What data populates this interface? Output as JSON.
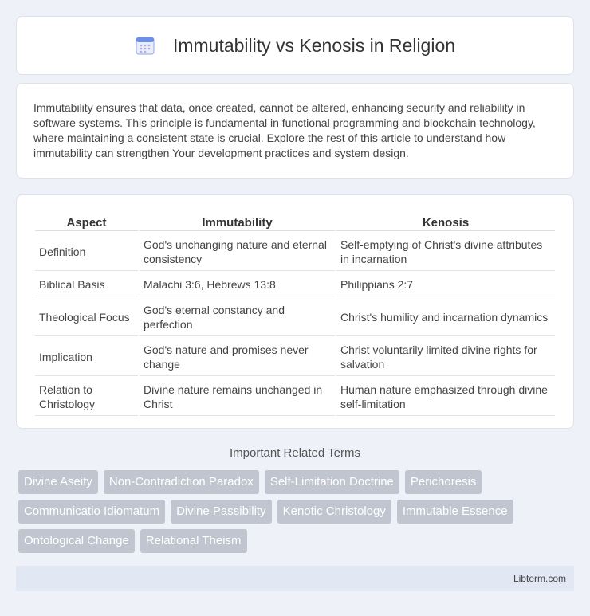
{
  "header": {
    "title": "Immutability vs Kenosis in Religion",
    "icon": "calendar-icon"
  },
  "intro": {
    "text": "Immutability ensures that data, once created, cannot be altered, enhancing security and reliability in software systems. This principle is fundamental in functional programming and blockchain technology, where maintaining a consistent state is crucial. Explore the rest of this article to understand how immutability can strengthen Your development practices and system design."
  },
  "table": {
    "headers": [
      "Aspect",
      "Immutability",
      "Kenosis"
    ],
    "rows": [
      [
        "Definition",
        "God's unchanging nature and eternal consistency",
        "Self-emptying of Christ's divine attributes in incarnation"
      ],
      [
        "Biblical Basis",
        "Malachi 3:6, Hebrews 13:8",
        "Philippians 2:7"
      ],
      [
        "Theological Focus",
        "God's eternal constancy and perfection",
        "Christ's humility and incarnation dynamics"
      ],
      [
        "Implication",
        "God's nature and promises never change",
        "Christ voluntarily limited divine rights for salvation"
      ],
      [
        "Relation to Christology",
        "Divine nature remains unchanged in Christ",
        "Human nature emphasized through divine self-limitation"
      ]
    ]
  },
  "terms": {
    "title": "Important Related Terms",
    "items": [
      "Divine Aseity",
      "Non-Contradiction Paradox",
      "Self-Limitation Doctrine",
      "Perichoresis",
      "Communicatio Idiomatum",
      "Divine Passibility",
      "Kenotic Christology",
      "Immutable Essence",
      "Ontological Change",
      "Relational Theism"
    ]
  },
  "footer": {
    "text": "Libterm.com"
  }
}
